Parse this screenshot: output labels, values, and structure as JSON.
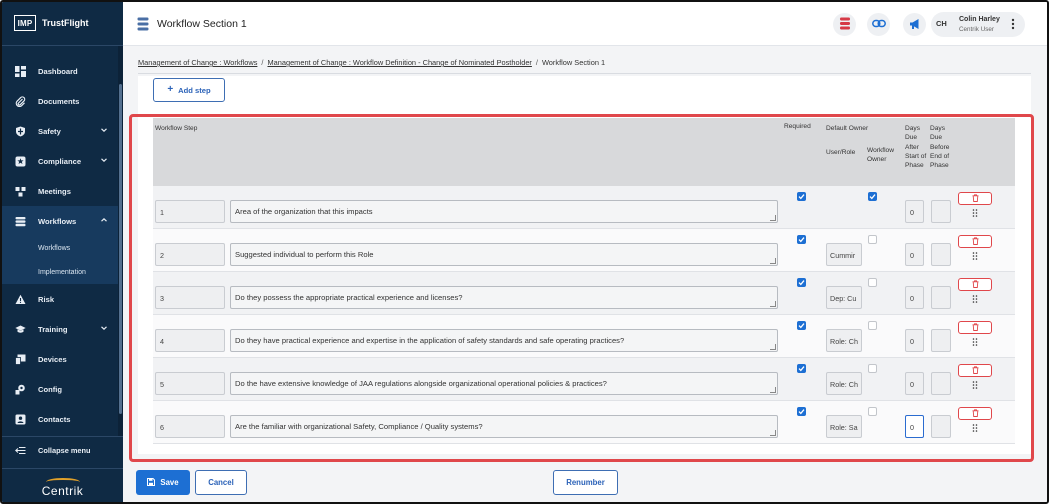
{
  "app": {
    "logo_text": "IMP",
    "name": "TrustFlight",
    "footer_brand": "Centrik"
  },
  "sidebar": {
    "items": [
      {
        "label": "Dashboard",
        "icon": "dashboard-icon"
      },
      {
        "label": "Documents",
        "icon": "paperclip-icon"
      },
      {
        "label": "Safety",
        "icon": "shield-icon",
        "chevron": "down"
      },
      {
        "label": "Compliance",
        "icon": "star-badge-icon",
        "chevron": "down"
      },
      {
        "label": "Meetings",
        "icon": "meetings-icon"
      },
      {
        "label": "Workflows",
        "icon": "layers-icon",
        "chevron": "up",
        "active": true
      },
      {
        "label": "Risk",
        "icon": "warning-icon"
      },
      {
        "label": "Training",
        "icon": "graduation-cap-icon",
        "chevron": "down"
      },
      {
        "label": "Devices",
        "icon": "devices-icon"
      },
      {
        "label": "Config",
        "icon": "config-icon"
      },
      {
        "label": "Contacts",
        "icon": "contacts-icon"
      }
    ],
    "workflows_sub": [
      "Workflows",
      "Implementation"
    ],
    "collapse_label": "Collapse menu"
  },
  "header": {
    "title": "Workflow Section 1",
    "user_initials": "CH",
    "user_name": "Colin Harley",
    "user_role": "Centrik User"
  },
  "breadcrumb": {
    "items": [
      "Management of Change : Workflows",
      "Management of Change : Workflow Definition - Change of Nominated Postholder",
      "Workflow Section 1"
    ],
    "separator": "/"
  },
  "toolbar": {
    "add_step_label": "Add step"
  },
  "table": {
    "headers": {
      "step": "Workflow Step",
      "required": "Required",
      "default_owner": "Default Owner",
      "user_role": "User/Role",
      "workflow_owner": "Workflow Owner",
      "days_after": "Days Due After Start of Phase",
      "days_before": "Days Due Before End of Phase"
    },
    "rows": [
      {
        "num": "1",
        "text": "Area of the organization that this impacts",
        "required": true,
        "user_role": "",
        "workflow_owner": true,
        "days_after": "0",
        "days_before": ""
      },
      {
        "num": "2",
        "text": "Suggested individual to perform this Role",
        "required": true,
        "user_role": "Cummir",
        "workflow_owner": false,
        "days_after": "0",
        "days_before": ""
      },
      {
        "num": "3",
        "text": "Do they possess the appropriate practical experience and licenses?",
        "required": true,
        "user_role": "Dep: Cu",
        "workflow_owner": false,
        "days_after": "0",
        "days_before": ""
      },
      {
        "num": "4",
        "text": "Do they have practical experience and expertise in the application of safety standards and safe operating practices?",
        "required": true,
        "user_role": "Role: Ch",
        "workflow_owner": false,
        "days_after": "0",
        "days_before": ""
      },
      {
        "num": "5",
        "text": "Do the have extensive knowledge of JAA regulations alongside organizational operational policies & practices?",
        "required": true,
        "user_role": "Role: Ch",
        "workflow_owner": false,
        "days_after": "0",
        "days_before": ""
      },
      {
        "num": "6",
        "text": "Are the familiar with organizational Safety, Compliance / Quality systems?",
        "required": true,
        "user_role": "Role: Sa",
        "workflow_owner": false,
        "days_after": "0",
        "days_before": ""
      }
    ]
  },
  "actions": {
    "save_label": "Save",
    "cancel_label": "Cancel",
    "renumber_label": "Renumber"
  },
  "colors": {
    "sidebar_bg": "#0f2a44",
    "primary": "#1d6fd3",
    "highlight": "#e0474b"
  }
}
